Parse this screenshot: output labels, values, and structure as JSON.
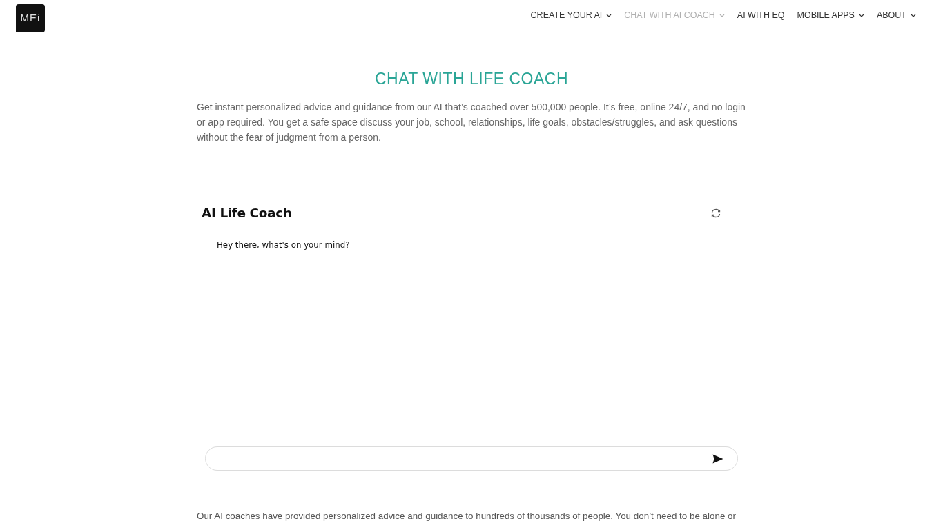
{
  "header": {
    "logo": "MEi",
    "nav": [
      {
        "label": "CREATE YOUR AI",
        "selected": false,
        "dropdown": true
      },
      {
        "label": "CHAT WITH AI COACH",
        "selected": true,
        "dropdown": true
      },
      {
        "label": "AI WITH EQ",
        "selected": false,
        "dropdown": false
      },
      {
        "label": "MOBILE APPS",
        "selected": false,
        "dropdown": true
      },
      {
        "label": "ABOUT",
        "selected": false,
        "dropdown": true
      }
    ]
  },
  "hero": {
    "title": "CHAT WITH LIFE COACH",
    "intro": "Get instant personalized advice and guidance from our AI that’s coached over 500,000 people.  It’s free, online 24/7, and no login or app required.  You get a safe space discuss your job, school, relationships, life goals, obstacles/struggles, and ask questions without the fear of judgment from a person."
  },
  "chat": {
    "title": "AI Life Coach",
    "messages": [
      {
        "text": "Hey there, what's on your mind?"
      }
    ]
  },
  "body_text": "Our AI coaches have provided personalized advice and guidance to hundreds of thousands of people.  You don’t need to be alone or"
}
